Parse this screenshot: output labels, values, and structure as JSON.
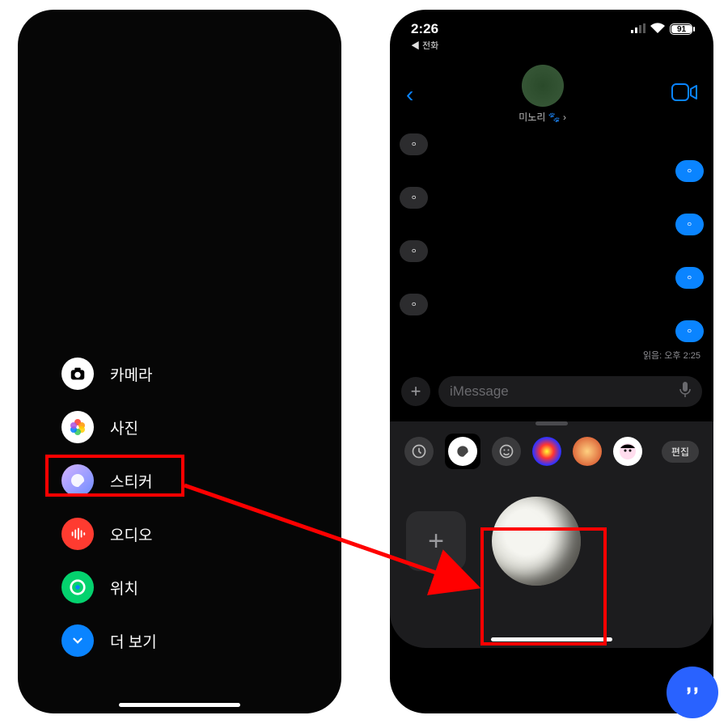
{
  "left_phone": {
    "menu": [
      {
        "icon": "camera",
        "label": "카메라"
      },
      {
        "icon": "photos",
        "label": "사진"
      },
      {
        "icon": "sticker",
        "label": "스티커"
      },
      {
        "icon": "audio",
        "label": "오디오"
      },
      {
        "icon": "location",
        "label": "위치"
      },
      {
        "icon": "more",
        "label": "더 보기"
      }
    ]
  },
  "right_phone": {
    "status": {
      "time": "2:26",
      "back_to": "◀ 전화",
      "battery": "91"
    },
    "contact": {
      "name": "미노리 🐾 ›"
    },
    "messages": [
      {
        "dir": "in",
        "text": "ㅇ"
      },
      {
        "dir": "out",
        "text": "ㅇ"
      },
      {
        "dir": "in",
        "text": "ㅇ"
      },
      {
        "dir": "out",
        "text": "ㅇ"
      },
      {
        "dir": "in",
        "text": "ㅇ"
      },
      {
        "dir": "out",
        "text": "ㅇ"
      },
      {
        "dir": "in",
        "text": "ㅇ"
      },
      {
        "dir": "out",
        "text": "ㅇ"
      }
    ],
    "read_receipt": "읽음: 오후 2:25",
    "compose": {
      "placeholder": "iMessage"
    },
    "drawer": {
      "edit_label": "편집"
    }
  },
  "annotation": {
    "highlight": "red"
  }
}
